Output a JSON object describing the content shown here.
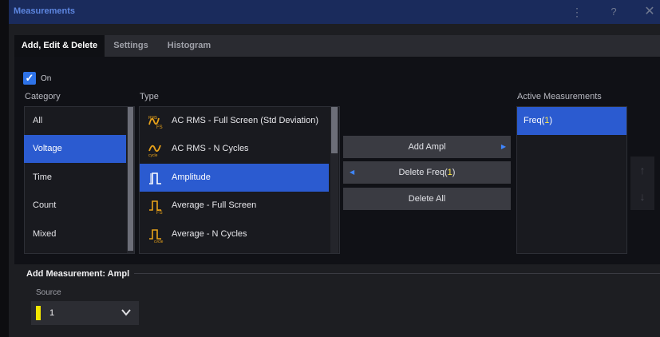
{
  "window": {
    "title": "Measurements"
  },
  "colors": {
    "accent": "#2b5bd0",
    "title_bar": "#1a2b5c",
    "channel_1": "#f2e600",
    "highlight": "#ffe94a"
  },
  "icons": {
    "menu": "vertical-dots-icon",
    "help": "question-icon",
    "close": "close-icon"
  },
  "tabs": [
    {
      "label": "Add, Edit & Delete",
      "active": true
    },
    {
      "label": "Settings",
      "active": false
    },
    {
      "label": "Histogram",
      "active": false
    }
  ],
  "on_toggle": {
    "label": "On",
    "checked": true
  },
  "category": {
    "header": "Category",
    "items": [
      "All",
      "Voltage",
      "Time",
      "Count",
      "Mixed"
    ],
    "selected": "Voltage"
  },
  "type": {
    "header": "Type",
    "items": [
      {
        "label": "AC RMS - Full Screen (Std Deviation)",
        "icon": "ac-rms-fs-icon",
        "selected": false
      },
      {
        "label": "AC RMS - N Cycles",
        "icon": "ac-rms-cycle-icon",
        "selected": false
      },
      {
        "label": "Amplitude",
        "icon": "amplitude-icon",
        "selected": true
      },
      {
        "label": "Average - Full Screen",
        "icon": "average-fs-icon",
        "selected": false
      },
      {
        "label": "Average - N Cycles",
        "icon": "average-cycle-icon",
        "selected": false
      }
    ]
  },
  "buttons": {
    "add_label": "Add  Ampl",
    "delete_prefix": "Delete Freq(",
    "delete_arg": "1",
    "delete_suffix": ")",
    "delete_all_label": "Delete All"
  },
  "active_measurements": {
    "header": "Active Measurements",
    "item_prefix": "Freq(",
    "item_arg": "1",
    "item_suffix": ")"
  },
  "footer": {
    "add_label": "Add Measurement: Ampl",
    "source_label": "Source",
    "source_value": "1"
  }
}
